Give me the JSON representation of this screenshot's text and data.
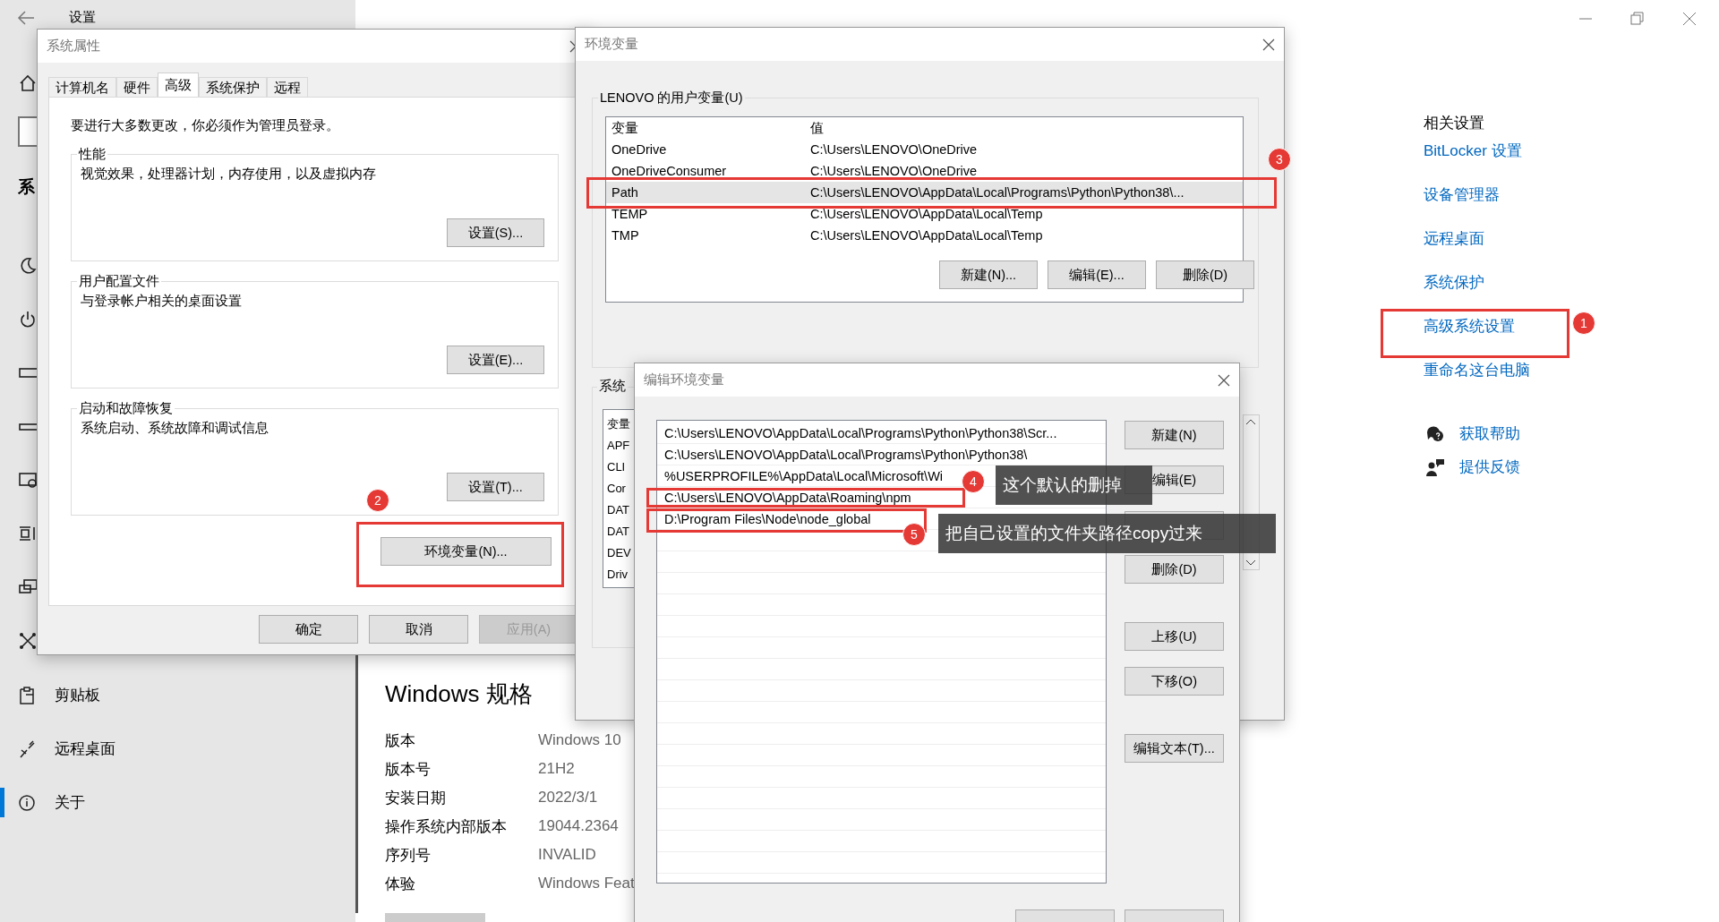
{
  "settings": {
    "title": "设置",
    "partial_heading": "系",
    "nav": [
      {
        "label": "剪贴板",
        "selected": false
      },
      {
        "label": "远程桌面",
        "selected": false
      },
      {
        "label": "关于",
        "selected": true
      }
    ],
    "specs": {
      "heading": "Windows 规格",
      "rows": [
        {
          "label": "版本",
          "value": "Windows 10"
        },
        {
          "label": "版本号",
          "value": "21H2"
        },
        {
          "label": "安装日期",
          "value": "2022/3/1"
        },
        {
          "label": "操作系统内部版本",
          "value": "19044.2364"
        },
        {
          "label": "序列号",
          "value": "INVALID"
        },
        {
          "label": "体验",
          "value": "Windows Feat"
        }
      ]
    },
    "related": {
      "heading": "相关设置",
      "links": [
        "BitLocker 设置",
        "设备管理器",
        "远程桌面",
        "系统保护",
        "高级系统设置",
        "重命名这台电脑"
      ],
      "support": [
        {
          "kind": "help",
          "label": "获取帮助"
        },
        {
          "kind": "feedback",
          "label": "提供反馈"
        }
      ]
    }
  },
  "system_properties": {
    "title": "系统属性",
    "tabs": [
      {
        "label": "计算机名",
        "selected": false
      },
      {
        "label": "硬件",
        "selected": false
      },
      {
        "label": "高级",
        "selected": true
      },
      {
        "label": "系统保护",
        "selected": false
      },
      {
        "label": "远程",
        "selected": false
      }
    ],
    "notice": "要进行大多数更改，你必须作为管理员登录。",
    "groups": [
      {
        "title": "性能",
        "description": "视觉效果，处理器计划，内存使用，以及虚拟内存",
        "button": "设置(S)..."
      },
      {
        "title": "用户配置文件",
        "description": "与登录帐户相关的桌面设置",
        "button": "设置(E)..."
      },
      {
        "title": "启动和故障恢复",
        "description": "系统启动、系统故障和调试信息",
        "button": "设置(T)..."
      }
    ],
    "env_button": "环境变量(N)...",
    "footer_buttons": [
      {
        "label": "确定",
        "disabled": false
      },
      {
        "label": "取消",
        "disabled": false
      },
      {
        "label": "应用(A)",
        "disabled": true
      }
    ]
  },
  "environment_variables": {
    "title": "环境变量",
    "user_group": "LENOVO 的用户变量(U)",
    "columns": [
      "变量",
      "值"
    ],
    "rows": [
      {
        "name": "OneDrive",
        "value": "C:\\Users\\LENOVO\\OneDrive",
        "selected": false
      },
      {
        "name": "OneDriveConsumer",
        "value": "C:\\Users\\LENOVO\\OneDrive",
        "selected": false
      },
      {
        "name": "Path",
        "value": "C:\\Users\\LENOVO\\AppData\\Local\\Programs\\Python\\Python38\\...",
        "selected": true
      },
      {
        "name": "TEMP",
        "value": "C:\\Users\\LENOVO\\AppData\\Local\\Temp",
        "selected": false
      },
      {
        "name": "TMP",
        "value": "C:\\Users\\LENOVO\\AppData\\Local\\Temp",
        "selected": false
      }
    ],
    "buttons": [
      "新建(N)...",
      "编辑(E)...",
      "删除(D)"
    ],
    "system_group": "系统",
    "system_rows": [
      "变量",
      "APF",
      "CLI",
      "Cor",
      "DAT",
      "DAT",
      "DEV",
      "Driv"
    ]
  },
  "edit_dialog": {
    "title": "编辑环境变量",
    "entries": [
      "C:\\Users\\LENOVO\\AppData\\Local\\Programs\\Python\\Python38\\Scr...",
      "C:\\Users\\LENOVO\\AppData\\Local\\Programs\\Python\\Python38\\",
      "%USERPROFILE%\\AppData\\Local\\Microsoft\\Wi",
      "C:\\Users\\LENOVO\\AppData\\Roaming\\npm",
      "D:\\Program Files\\Node\\node_global"
    ],
    "buttons": [
      "新建(N)",
      "编辑(E)",
      "删除(D)",
      "上移(U)",
      "下移(O)",
      "编辑文本(T)..."
    ]
  },
  "annotations": [
    {
      "badge": "1"
    },
    {
      "badge": "2"
    },
    {
      "badge": "3"
    },
    {
      "badge": "4",
      "note": "这个默认的删掉"
    },
    {
      "badge": "5",
      "note": "把自己设置的文件夹路径copy过来"
    }
  ]
}
